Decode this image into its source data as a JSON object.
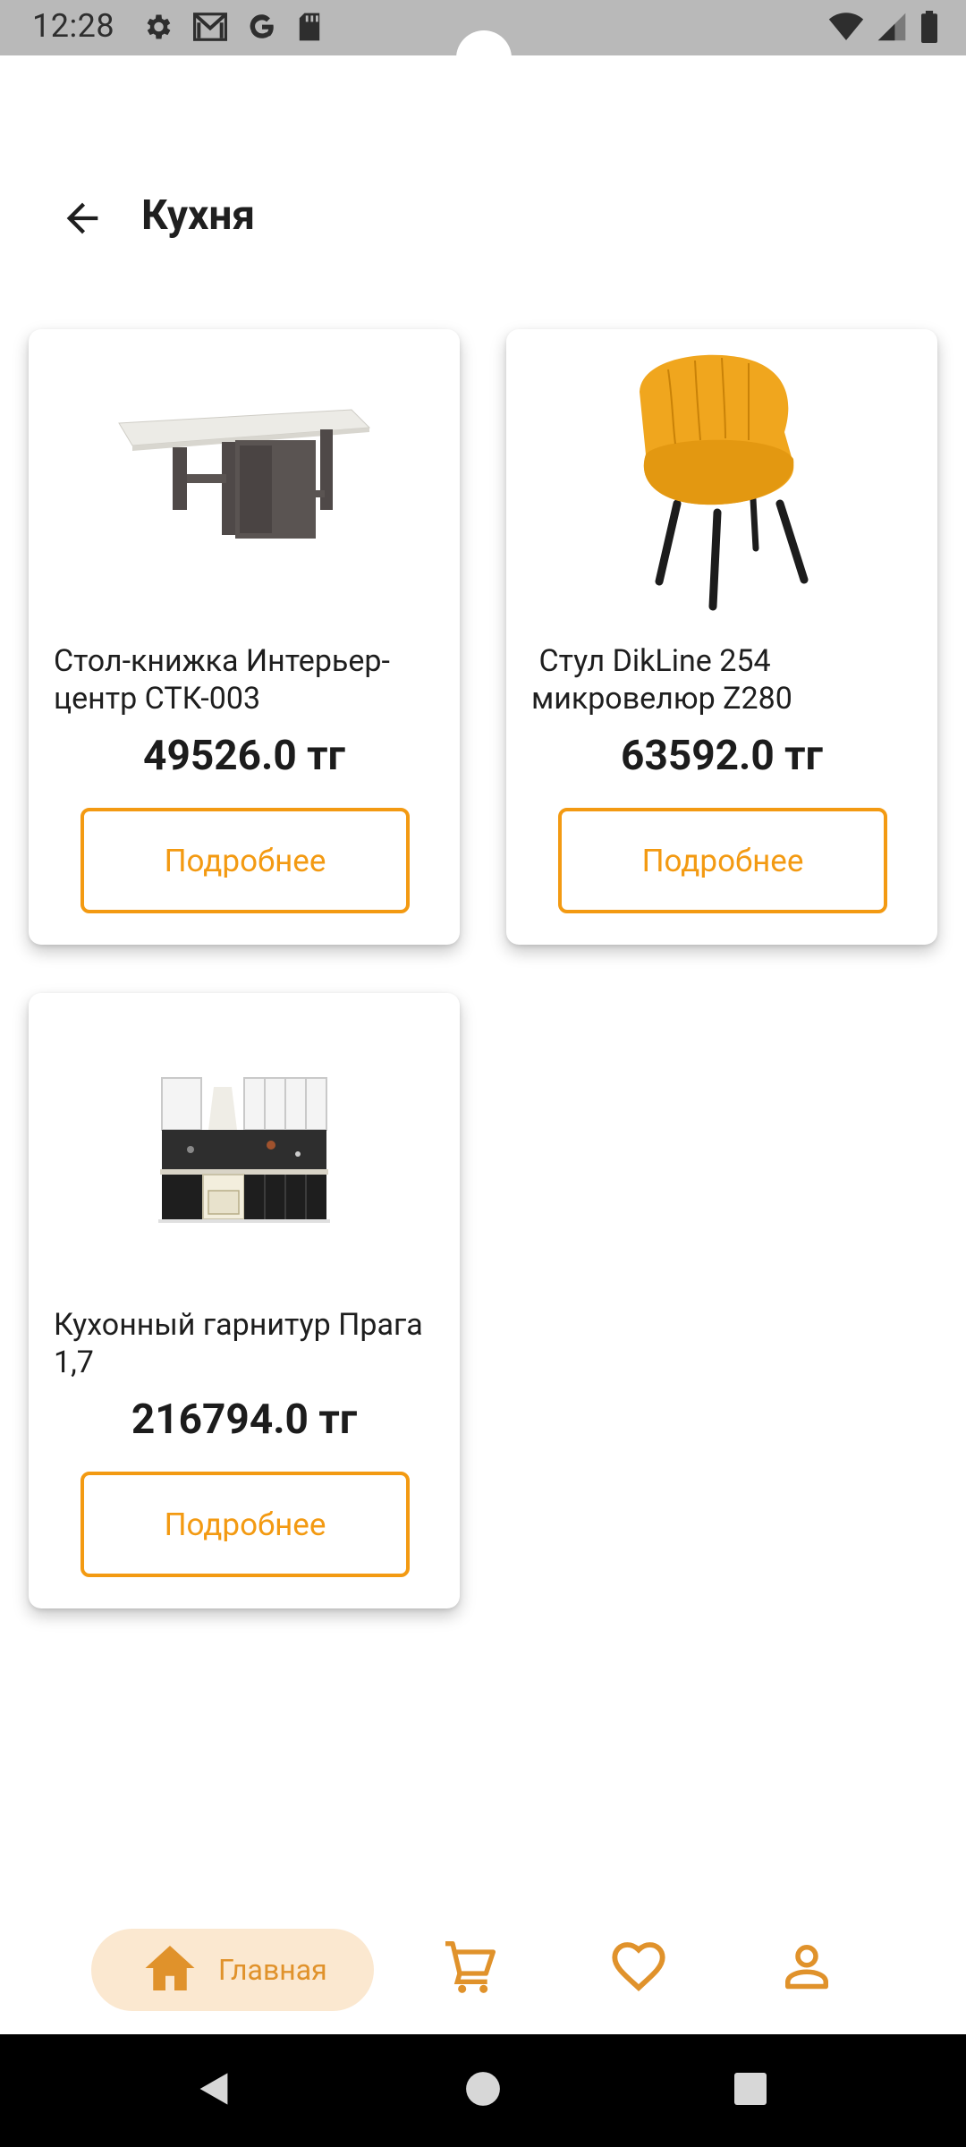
{
  "status_bar": {
    "time": "12:28",
    "left_icons": [
      "gear-icon",
      "gmail-icon",
      "google-icon",
      "sd-card-icon"
    ],
    "right_icons": [
      "wifi-icon",
      "cell-signal-icon",
      "battery-icon"
    ]
  },
  "app_bar": {
    "title": "Кухня",
    "back_icon": "arrow-left-icon"
  },
  "products": [
    {
      "name": "Стол-книжка Интерьер-центр СТК-003",
      "price": "49526.0 тг",
      "button_label": "Подробнее",
      "image": "folding-table"
    },
    {
      "name": " Стул DikLine 254 микровелюр Z280",
      "price": "63592.0 тг",
      "button_label": "Подробнее",
      "image": "yellow-chair"
    },
    {
      "name": "Кухонный гарнитур Прага 1,7",
      "price": "216794.0 тг",
      "button_label": "Подробнее",
      "image": "kitchen-set"
    }
  ],
  "bottom_nav": {
    "home_label": "Главная",
    "items": [
      "home-icon",
      "cart-icon",
      "heart-icon",
      "profile-icon"
    ]
  },
  "colors": {
    "accent": "#f39a12",
    "nav_accent": "#e0922b",
    "nav_pill_bg": "#fbe8d0",
    "status_bar_bg": "#b9b9b9"
  },
  "system_nav": [
    "back-triangle-icon",
    "home-circle-icon",
    "recents-square-icon"
  ]
}
